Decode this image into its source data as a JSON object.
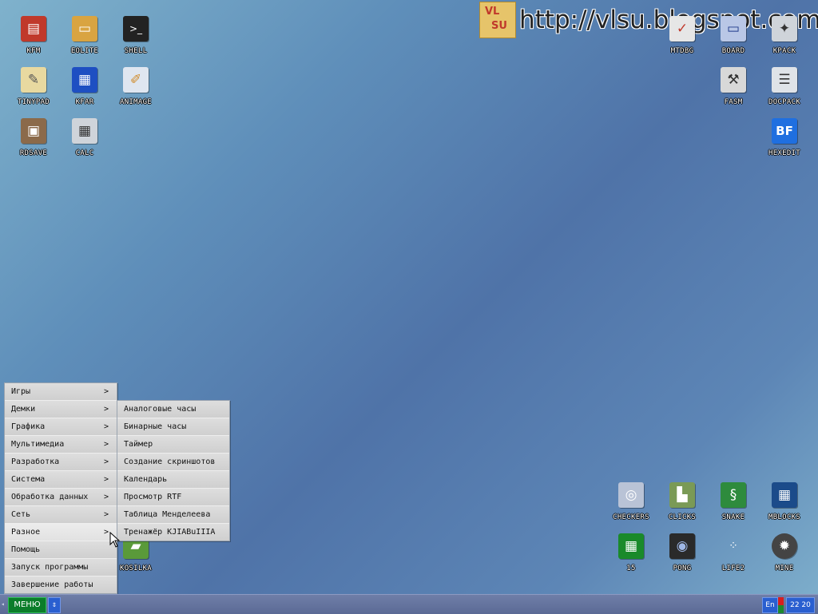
{
  "watermark": {
    "logo_letters": [
      "VL",
      "SU"
    ],
    "url": "http://vlsu.blogspot.com"
  },
  "desktop": {
    "icons": {
      "kfm": {
        "label": "KFM",
        "icon": "floppy-icon",
        "color": "#c0392b"
      },
      "eolite": {
        "label": "EOLITE",
        "icon": "folder-icon",
        "color": "#d9a441"
      },
      "shell": {
        "label": "SHELL",
        "icon": "terminal-icon",
        "color": "#222222"
      },
      "tinypad": {
        "label": "TINYPAD",
        "icon": "notepad-icon",
        "color": "#e8d9a0"
      },
      "kfar": {
        "label": "KFAR",
        "icon": "kfar-icon",
        "color": "#1e4fc2"
      },
      "animage": {
        "label": "ANIMAGE",
        "icon": "paint-icon",
        "color": "#dfe6f0"
      },
      "rdsave": {
        "label": "RDSAVE",
        "icon": "disk-save-icon",
        "color": "#8b6a4a"
      },
      "calc": {
        "label": "CALC",
        "icon": "calculator-icon",
        "color": "#cfd4da"
      },
      "mtdbg": {
        "label": "MTDBG",
        "icon": "debugger-icon",
        "color": "#e6e6e6"
      },
      "board": {
        "label": "BOARD",
        "icon": "board-icon",
        "color": "#b9c7e6"
      },
      "kpack": {
        "label": "KPACK",
        "icon": "package-icon",
        "color": "#cfd4da"
      },
      "fasm": {
        "label": "FASM",
        "icon": "fasm-icon",
        "color": "#d8d8d8"
      },
      "docpack": {
        "label": "DOCPACK",
        "icon": "cabinet-icon",
        "color": "#dfe3e8"
      },
      "hexedit": {
        "label": "HEXEDIT",
        "icon": "hexedit-icon",
        "color": "#1f6fe0"
      },
      "checkers": {
        "label": "CHECKERS",
        "icon": "checkers-icon",
        "color": "#b9c3d6"
      },
      "clicks": {
        "label": "CLICKS",
        "icon": "clicks-icon",
        "color": "#7a9a56"
      },
      "snake": {
        "label": "SNAKE",
        "icon": "snake-icon",
        "color": "#2e8b3d"
      },
      "mblocks": {
        "label": "MBLOCKS",
        "icon": "mblocks-icon",
        "color": "#1b4b8a"
      },
      "fifteen": {
        "label": "15",
        "icon": "fifteen-icon",
        "color": "#1a8a2a"
      },
      "pong": {
        "label": "PONG",
        "icon": "pong-icon",
        "color": "#2a2a2a"
      },
      "life2": {
        "label": "LIFE2",
        "icon": "life-icon",
        "color": "#ffffff"
      },
      "mine": {
        "label": "MINE",
        "icon": "mine-icon",
        "color": "#444444"
      },
      "kosilka": {
        "label": "KOSILKA",
        "icon": "tank-icon",
        "color": "#5a9a3a"
      }
    }
  },
  "menu": {
    "items": [
      {
        "label": "Игры",
        "arrow": ">"
      },
      {
        "label": "Демки",
        "arrow": ">"
      },
      {
        "label": "Графика",
        "arrow": ">"
      },
      {
        "label": "Мультимедиа",
        "arrow": ">"
      },
      {
        "label": "Разработка",
        "arrow": ">"
      },
      {
        "label": "Система",
        "arrow": ">"
      },
      {
        "label": "Обработка данных",
        "arrow": ">"
      },
      {
        "label": "Сеть",
        "arrow": ">"
      },
      {
        "label": "Разное",
        "arrow": ">"
      },
      {
        "label": "Помощь",
        "arrow": ""
      },
      {
        "label": "Запуск программы",
        "arrow": ""
      },
      {
        "label": "Завершение работы",
        "arrow": ""
      }
    ],
    "active_index": 8
  },
  "submenu": {
    "items": [
      {
        "label": "Аналоговые часы"
      },
      {
        "label": "Бинарные часы"
      },
      {
        "label": "Таймер"
      },
      {
        "label": "Создание скриншотов"
      },
      {
        "label": "Календарь"
      },
      {
        "label": "Просмотр RTF"
      },
      {
        "label": "Таблица Менделеева"
      },
      {
        "label": "Тренажёр KJIABuIIIA"
      }
    ]
  },
  "taskbar": {
    "left_marker": "◂",
    "menu_button": "МЕНЮ",
    "arrows": "⇕",
    "lang": "En",
    "clock": "22 20",
    "accent": "#0b7d2a"
  }
}
